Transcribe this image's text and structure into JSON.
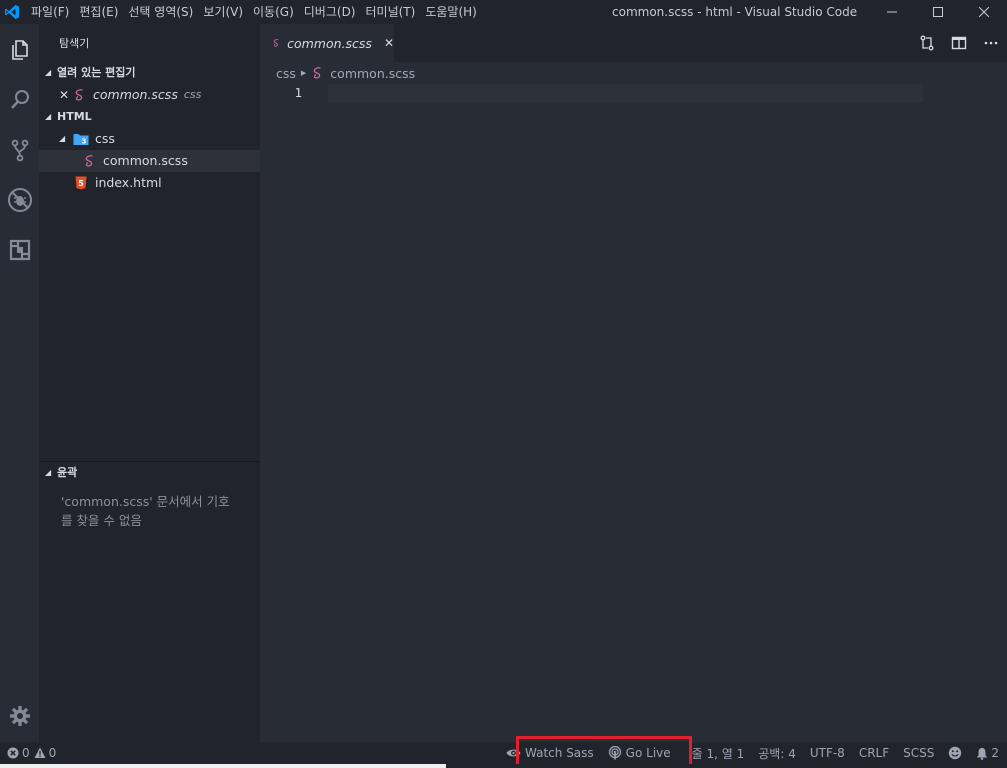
{
  "titlebar": {
    "menu": [
      "파일(F)",
      "편집(E)",
      "선택 영역(S)",
      "보기(V)",
      "이동(G)",
      "디버그(D)",
      "터미널(T)",
      "도움말(H)"
    ],
    "window_title": "common.scss - html - Visual Studio Code"
  },
  "sidebar": {
    "title": "탐색기",
    "open_editors": {
      "header": "열려 있는 편집기",
      "item_name": "common.scss",
      "item_folder": "css"
    },
    "workspace": {
      "header": "HTML",
      "folder": "css",
      "file_selected": "common.scss",
      "file_other": "index.html"
    },
    "outline": {
      "header": "윤곽",
      "message": "'common.scss' 문서에서 기호를 찾을 수 없음"
    }
  },
  "editor": {
    "tab_label": "common.scss",
    "breadcrumb": [
      "css",
      "common.scss"
    ],
    "line_numbers": [
      "1"
    ]
  },
  "statusbar": {
    "errors": "0",
    "warnings": "0",
    "watch_sass": "Watch Sass",
    "go_live": "Go Live",
    "position": "줄 1, 열 1",
    "spaces": "공백: 4",
    "encoding": "UTF-8",
    "eol": "CRLF",
    "language": "SCSS",
    "notifications": "2"
  },
  "colors": {
    "sass_pink": "#cd6799",
    "html_orange": "#e44d26",
    "css_blue": "#42a5f5",
    "vscode_blue": "#0098ff",
    "highlight_red": "#e0202f"
  }
}
